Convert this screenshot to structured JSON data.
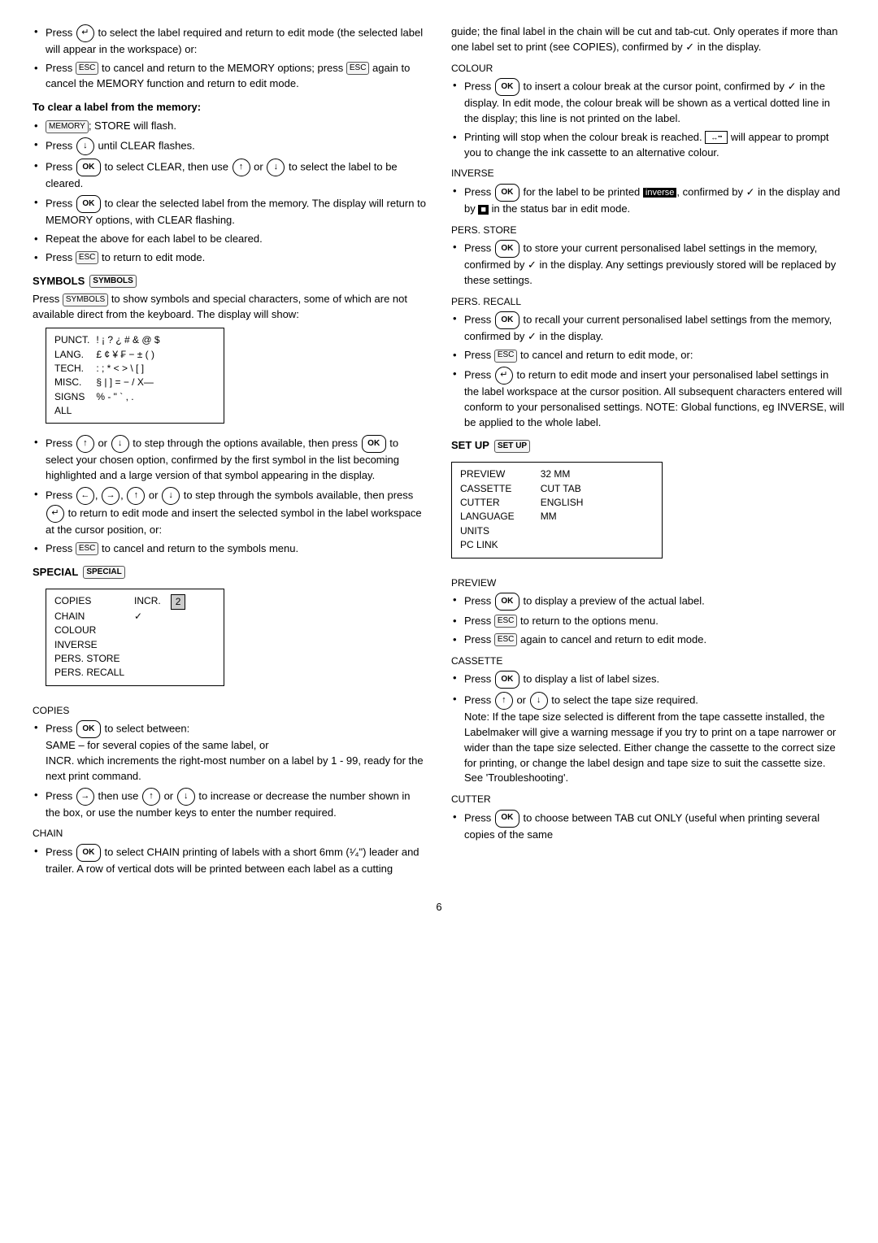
{
  "page": {
    "number": "6",
    "left_col": {
      "intro_bullets": [
        "Press <key-enter> to select the label required and return to edit mode (the selected label will appear in the workspace) or:",
        "Press <esc> to cancel and return to the MEMORY options; press <esc> again to cancel the MEMORY function and return to edit mode."
      ],
      "clear_heading": "To clear a label from the memory:",
      "clear_bullets": [
        "<key-memory>; STORE will flash.",
        "Press <down> until CLEAR flashes.",
        "Press <ok> to select CLEAR, then use <up> or <down> to select the label to be cleared.",
        "Press <ok> to clear the selected label from the memory. The display will return to MEMORY options, with CLEAR flashing.",
        "Repeat the above for each label to be cleared.",
        "Press <esc> to return to edit mode."
      ],
      "symbols_section": {
        "label": "SYMBOLS",
        "badge": "SYMBOLS",
        "intro": "Press <symbols> to show symbols and special characters, some of which are not available direct from the keyboard. The display will show:",
        "table": {
          "rows": [
            [
              "PUNCT.",
              "! ¡ ? ¿ # & @ $"
            ],
            [
              "LANG.",
              "£ ¢ ¥ ₣ − ± ( )"
            ],
            [
              "TECH.",
              ": ; * < > \\ [ ]"
            ],
            [
              "MISC.",
              "§ | ] = − / X—"
            ],
            [
              "SIGNS",
              "% - \" ` , ."
            ],
            [
              "ALL",
              ""
            ]
          ]
        },
        "bullets_after": [
          "Press <up> or <down> to step through the options available, then press <ok> to select your chosen option, confirmed by the first symbol in the list becoming highlighted and a large version of that symbol appearing in the display.",
          "Press <left>, <right>, <up> or <down> to step through the symbols available, then press <enter> to return to edit mode and insert the selected symbol in the label workspace at the cursor position, or:",
          "Press <esc> to cancel and return to the symbols menu."
        ]
      },
      "special_section": {
        "label": "SPECIAL",
        "badge": "SPECIAL",
        "table": {
          "rows": [
            [
              "COPIES",
              "INCR.",
              "2"
            ],
            [
              "CHAIN",
              "✓",
              ""
            ],
            [
              "COLOUR",
              "",
              ""
            ],
            [
              "INVERSE",
              "",
              ""
            ],
            [
              "PERS. STORE",
              "",
              ""
            ],
            [
              "PERS. RECALL",
              "",
              ""
            ]
          ]
        }
      },
      "copies_section": {
        "label": "COPIES",
        "bullets": [
          "Press <ok> to select between: SAME – for several copies of the same label, or INCR. which increments the right-most number on a label by 1 - 99, ready for the next print command.",
          "Press <right> then use <up> or <down> to increase or decrease the number shown in the box, or use the number keys to enter the number required."
        ]
      },
      "chain_section": {
        "label": "CHAIN",
        "bullets": [
          "Press <ok> to select CHAIN printing of labels with a short 6mm (¹⁄₄\") leader and trailer. A row of vertical dots will be printed between each label as a cutting"
        ]
      }
    },
    "right_col": {
      "intro_text": "guide; the final label in the chain will be cut and tab-cut. Only operates if more than one label set to print (see COPIES), confirmed by ✓ in the display.",
      "colour_section": {
        "label": "COLOUR",
        "bullets": [
          "Press <ok> to insert a colour break at the cursor point, confirmed by ✓ in the display. In edit mode, the colour break will be shown as a vertical dotted line in the display; this line is not printed on the label.",
          "Printing will stop when the colour break is reached. <tape-icon> will appear to prompt you to change the ink cassette to an alternative colour."
        ]
      },
      "inverse_section": {
        "label": "INVERSE",
        "bullets": [
          "Press <ok> for the label to be printed <inverse-text>, confirmed by ✓ in the display and by <black-square> in the status bar in edit mode."
        ]
      },
      "pers_store_section": {
        "label": "PERS. STORE",
        "bullets": [
          "Press <ok> to store your current personalised label settings in the memory, confirmed by ✓ in the display. Any settings previously stored will be replaced by these settings."
        ]
      },
      "pers_recall_section": {
        "label": "PERS. RECALL",
        "bullets": [
          "Press <ok> to recall your current personalised label settings from the memory, confirmed by ✓ in the display.",
          "Press <esc> to cancel and return to edit mode, or:",
          "Press <enter> to return to edit mode and insert your personalised label settings in the label workspace at the cursor position. All subsequent characters entered will conform to your personalised settings. NOTE: Global functions, eg INVERSE, will be applied to the whole label."
        ]
      },
      "setup_section": {
        "label": "SET UP",
        "badge": "SET UP",
        "table": {
          "rows": [
            [
              "PREVIEW",
              "",
              "32  MM",
              ""
            ],
            [
              "CASSETTE",
              "",
              "CUT TAB",
              ""
            ],
            [
              "CUTTER",
              "",
              "ENGLISH",
              ""
            ],
            [
              "LANGUAGE",
              "",
              "MM",
              ""
            ],
            [
              "UNITS",
              "",
              "",
              ""
            ],
            [
              "PC LINK",
              "",
              "",
              ""
            ]
          ],
          "left_col": [
            "PREVIEW",
            "CASSETTE",
            "CUTTER",
            "LANGUAGE",
            "UNITS",
            "PC LINK"
          ],
          "right_col": [
            "32  MM",
            "CUT TAB",
            "ENGLISH",
            "MM",
            "",
            ""
          ]
        }
      },
      "preview_section": {
        "label": "PREVIEW",
        "bullets": [
          "Press <ok> to display a preview of the actual label.",
          "Press <esc> to return to the options menu.",
          "Press <esc> again to cancel and return to edit mode."
        ]
      },
      "cassette_section": {
        "label": "CASSETTE",
        "bullets": [
          "Press <ok> to display a list of label sizes.",
          "Press <up> or <down> to select the tape size required. Note: If the tape size selected is different from the tape cassette installed, the Labelmaker will give a warning message if you try to print on a tape narrower or wider than the tape size selected. Either change the cassette to the correct size for printing, or change the label design and tape size to suit the cassette size. See 'Troubleshooting'."
        ]
      },
      "cutter_section": {
        "label": "CUTTER",
        "bullets": [
          "Press <ok> to choose between TAB cut ONLY (useful when printing several copies of the same"
        ]
      }
    }
  }
}
